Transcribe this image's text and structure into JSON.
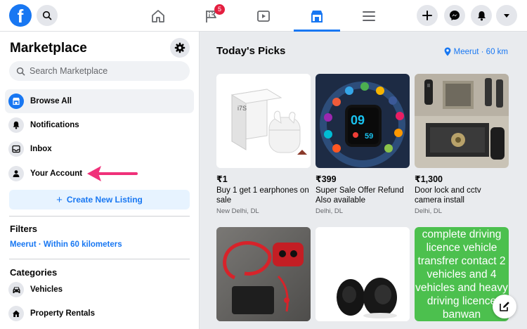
{
  "colors": {
    "brand": "#1877f2",
    "badge": "#e41e3f",
    "arrow": "#f0317a",
    "listing_green": "#4cc04e"
  },
  "topbar": {
    "logo": "f",
    "notifications_badge": "5",
    "icons": [
      "search-icon",
      "home-icon",
      "flag-icon",
      "watch-icon",
      "marketplace-icon",
      "menu-icon",
      "plus-icon",
      "messenger-icon",
      "bell-icon",
      "caret-down-icon"
    ],
    "active_tab": "marketplace"
  },
  "sidebar": {
    "title": "Marketplace",
    "search_placeholder": "Search Marketplace",
    "items": [
      {
        "label": "Browse All",
        "icon": "storefront-icon",
        "active": true
      },
      {
        "label": "Notifications",
        "icon": "bell-icon"
      },
      {
        "label": "Inbox",
        "icon": "inbox-icon"
      },
      {
        "label": "Your Account",
        "icon": "person-icon"
      }
    ],
    "create_label": "Create New Listing",
    "filters_heading": "Filters",
    "filter_value": "Meerut · Within 60 kilometers",
    "categories_heading": "Categories",
    "categories": [
      {
        "label": "Vehicles",
        "icon": "car-icon"
      },
      {
        "label": "Property Rentals",
        "icon": "house-icon"
      }
    ]
  },
  "main": {
    "title": "Today's Picks",
    "location": "Meerut · 60 km",
    "listings": [
      {
        "price": "₹1",
        "title": "Buy 1 get 1 earphones on sale",
        "location": "New Delhi, DL"
      },
      {
        "price": "₹399",
        "title": "Super Sale Offer Refund Also available",
        "location": "Delhi, DL",
        "watch_time": "09",
        "watch_sub": "59"
      },
      {
        "price": "₹1,300",
        "title": "Door lock and cctv camera install",
        "location": "Delhi, DL"
      },
      {
        "price": "",
        "title": "",
        "location": ""
      },
      {
        "price": "",
        "title": "",
        "location": ""
      },
      {
        "price": "",
        "title": "",
        "location": "",
        "image_text": "complete driving licence vehicle transfrer contact 2 vehicles and 4 vehicles and heavy driving licence banwan"
      }
    ],
    "box_label": "i7S"
  }
}
